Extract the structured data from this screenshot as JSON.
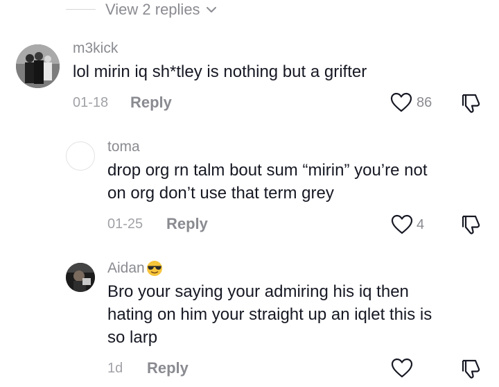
{
  "view_replies": {
    "label": "View 2 replies"
  },
  "comments": [
    {
      "username": "m3kick",
      "text": "lol mirin iq sh*tley is nothing but a grifter",
      "date": "01-18",
      "reply_label": "Reply",
      "likes": "86",
      "avatar": "group-photo"
    },
    {
      "username": "toma",
      "text_lines": [
        "drop org rn talm bout sum “mirin” you’re not",
        "on org don’t use that term grey"
      ],
      "date": "01-25",
      "reply_label": "Reply",
      "likes": "4",
      "avatar": "blank"
    },
    {
      "username": "Aidan",
      "username_emoji": "sunglasses-emoji",
      "text_lines": [
        "Bro your saying your admiring his iq then",
        "hating on him your straight up an iqlet this is",
        "so larp"
      ],
      "date": "1d",
      "reply_label": "Reply",
      "likes": "",
      "avatar": "dark-photo"
    }
  ],
  "icons": {
    "like": "heart-outline-icon",
    "dislike": "thumbs-down-icon",
    "expand": "chevron-down-icon"
  },
  "colors": {
    "text": "#161823",
    "muted": "#8a8b91",
    "light": "#a1a2a7"
  }
}
